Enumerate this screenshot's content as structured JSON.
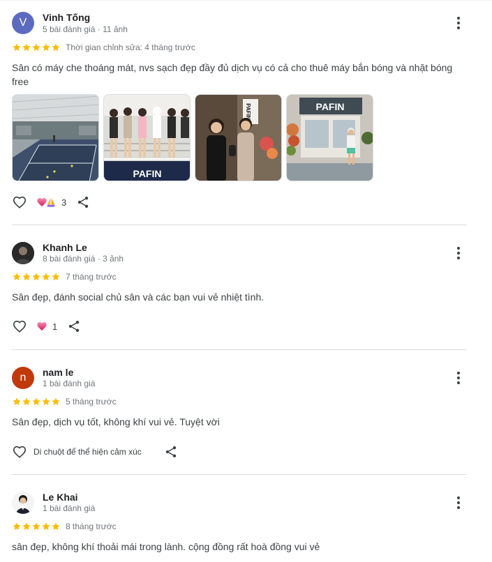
{
  "colors": {
    "star": "#fbbc04",
    "heart": "#e8457a",
    "avatar_v": "#5c6bc0",
    "avatar_n": "#c1390a"
  },
  "reviews": [
    {
      "name": "Vinh Tống",
      "avatar_letter": "V",
      "meta": "5 bài đánh giá · 11 ảnh",
      "rating": 5,
      "time": "Thời gian chỉnh sửa: 4 tháng trước",
      "text": "Sân có máy che thoáng mát, nvs sạch đẹp đầy đủ dịch vụ có cả cho thuê máy bắn bóng và nhặt bóng free",
      "photo_count": 4,
      "photo_signs": [
        "PAFIN",
        "PAFIN"
      ],
      "reactions": [
        "heart",
        "praying-hands"
      ],
      "reaction_count": "3"
    },
    {
      "name": "Khanh Le",
      "avatar_letter": "",
      "meta": "8 bài đánh giá · 3 ảnh",
      "rating": 5,
      "time": "7 tháng trước",
      "text": "Sân đẹp, đánh social chủ sân và các bạn vui vẻ nhiệt tình.",
      "reactions": [
        "heart"
      ],
      "reaction_count": "1"
    },
    {
      "name": "nam le",
      "avatar_letter": "n",
      "meta": "1 bài đánh giá",
      "rating": 5,
      "time": "5 tháng trước",
      "text": "Sân đẹp, dịch vụ tốt, không khí vui vẻ. Tuyệt vời",
      "reaction_hint": "Di chuột để thể hiện cảm xúc"
    },
    {
      "name": "Le Khai",
      "avatar_letter": "",
      "meta": "1 bài đánh giá",
      "rating": 5,
      "time": "8 tháng trước",
      "text": "sân đẹp, không khí thoải mái trong lành. cộng đồng rất hoà đồng vui vẻ"
    }
  ]
}
